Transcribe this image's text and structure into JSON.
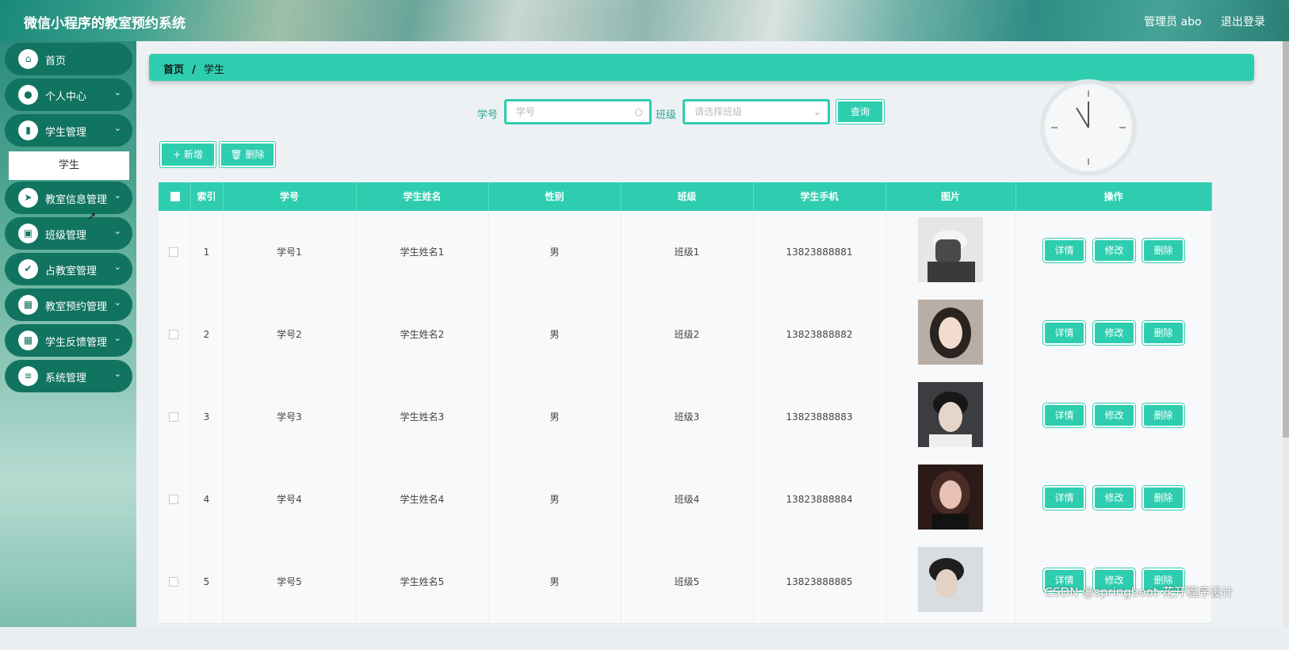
{
  "header": {
    "title": "微信小程序的教室预约系统",
    "user": "管理员 abo",
    "logout": "退出登录"
  },
  "sidebar": {
    "items": [
      {
        "label": "首页",
        "icon": "home-icon",
        "glyph": "⌂",
        "chevron": false
      },
      {
        "label": "个人中心",
        "icon": "user-icon",
        "glyph": "●",
        "chevron": true
      },
      {
        "label": "学生管理",
        "icon": "bar-chart-icon",
        "glyph": "▮",
        "chevron": true
      },
      {
        "label": "教室信息管理",
        "icon": "send-icon",
        "glyph": "➤",
        "chevron": true
      },
      {
        "label": "班级管理",
        "icon": "book-icon",
        "glyph": "▣",
        "chevron": true
      },
      {
        "label": "占教室管理",
        "icon": "clipboard-check-icon",
        "glyph": "✔",
        "chevron": true
      },
      {
        "label": "教室预约管理",
        "icon": "grid-icon",
        "glyph": "▦",
        "chevron": true
      },
      {
        "label": "学生反馈管理",
        "icon": "grid-icon",
        "glyph": "▦",
        "chevron": true
      },
      {
        "label": "系统管理",
        "icon": "sliders-icon",
        "glyph": "≡",
        "chevron": true
      }
    ],
    "sub_item": "学生"
  },
  "breadcrumb": {
    "home": "首页",
    "sep": "/",
    "current": "学生"
  },
  "search": {
    "id_label": "学号",
    "id_placeholder": "学号",
    "class_label": "班级",
    "class_placeholder": "请选择班级",
    "query_button": "查询"
  },
  "toolbar": {
    "add_button": "+ 新增",
    "delete_button": "🗑 删除"
  },
  "table": {
    "headers": [
      "",
      "索引",
      "学号",
      "学生姓名",
      "性别",
      "班级",
      "学生手机",
      "图片",
      "操作"
    ],
    "actions": {
      "detail": "详情",
      "edit": "修改",
      "delete": "删除"
    },
    "rows": [
      {
        "index": "1",
        "id": "学号1",
        "name": "学生姓名1",
        "gender": "男",
        "class": "班级1",
        "phone": "13823888881"
      },
      {
        "index": "2",
        "id": "学号2",
        "name": "学生姓名2",
        "gender": "男",
        "class": "班级2",
        "phone": "13823888882"
      },
      {
        "index": "3",
        "id": "学号3",
        "name": "学生姓名3",
        "gender": "男",
        "class": "班级3",
        "phone": "13823888883"
      },
      {
        "index": "4",
        "id": "学号4",
        "name": "学生姓名4",
        "gender": "男",
        "class": "班级4",
        "phone": "13823888884"
      },
      {
        "index": "5",
        "id": "学号5",
        "name": "学生姓名5",
        "gender": "男",
        "class": "班级5",
        "phone": "13823888885"
      }
    ]
  },
  "watermark": "CSDN @springboot-花开程序设计"
}
